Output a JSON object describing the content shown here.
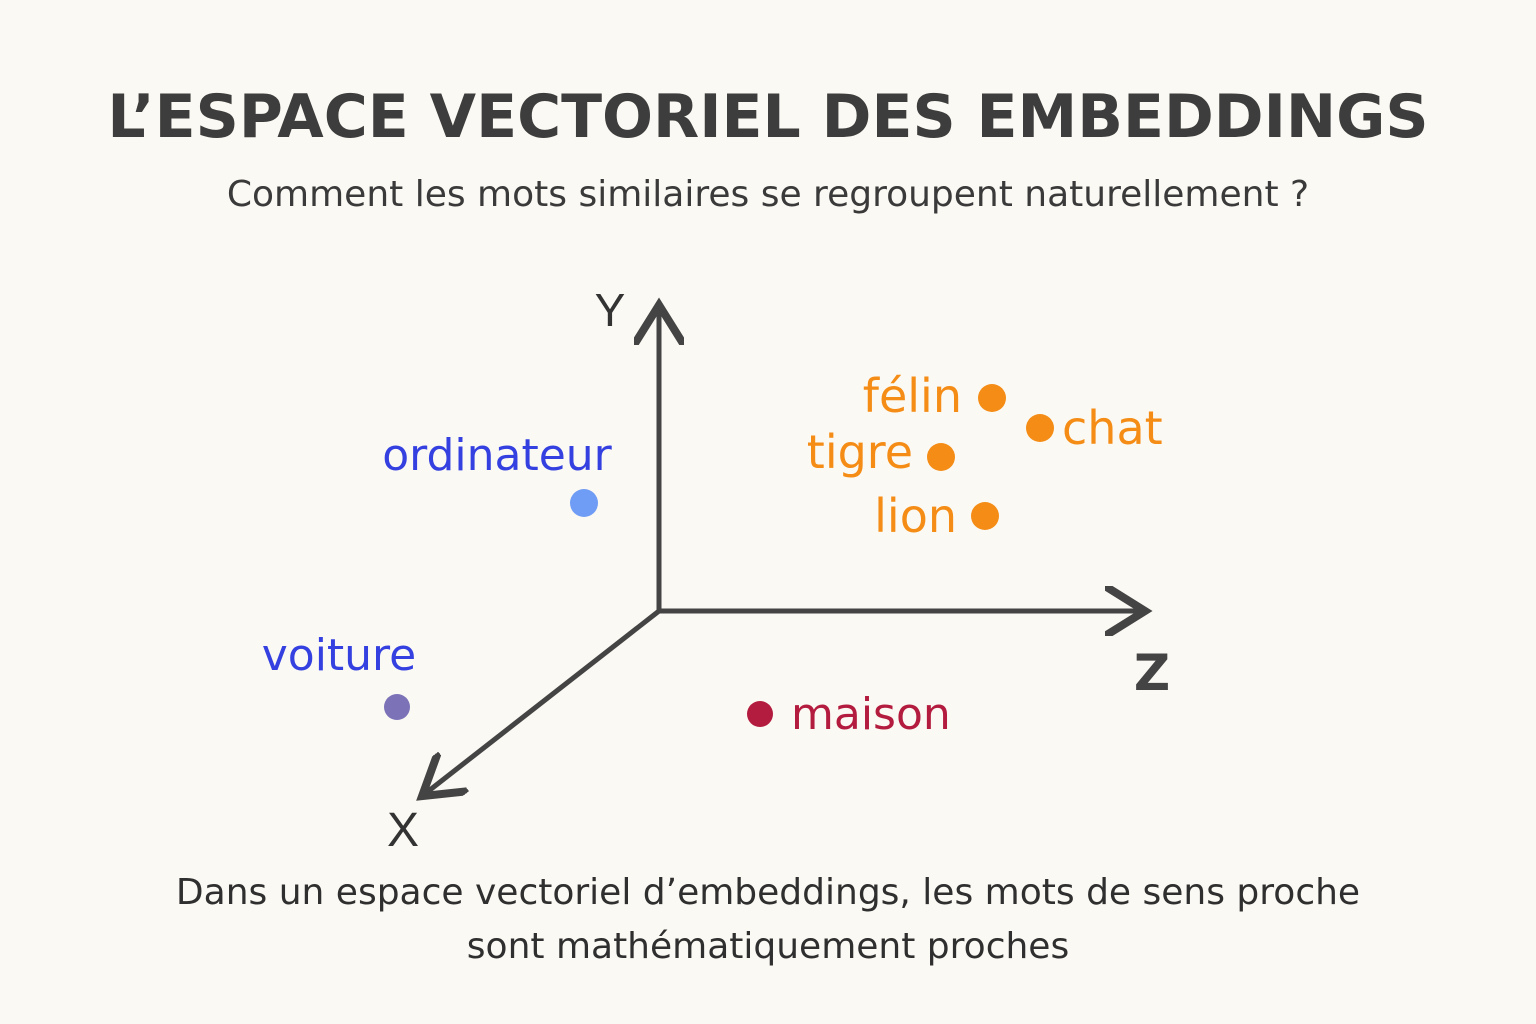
{
  "title": "L’ESPACE VECTORIEL DES EMBEDDINGS",
  "subtitle": "Comment les mots similaires se regroupent naturellement ?",
  "axes": {
    "x": "X",
    "y": "Y",
    "z": "Z"
  },
  "colors": {
    "background": "#fbf9f3",
    "axis": "#444444",
    "animals": "#f48c16",
    "tech": "#3440e0",
    "ordinateur_dot": "#6f9cf4",
    "voiture_dot": "#7b72b8",
    "maison": "#b31c3e"
  },
  "points": {
    "felin": "félin",
    "chat": "chat",
    "tigre": "tigre",
    "lion": "lion",
    "ordinateur": "ordinateur",
    "voiture": "voiture",
    "maison": "maison"
  },
  "caption": {
    "line1": "Dans un espace vectoriel d’embeddings, les mots de sens proche",
    "line2": "sont mathématiquement proches"
  }
}
